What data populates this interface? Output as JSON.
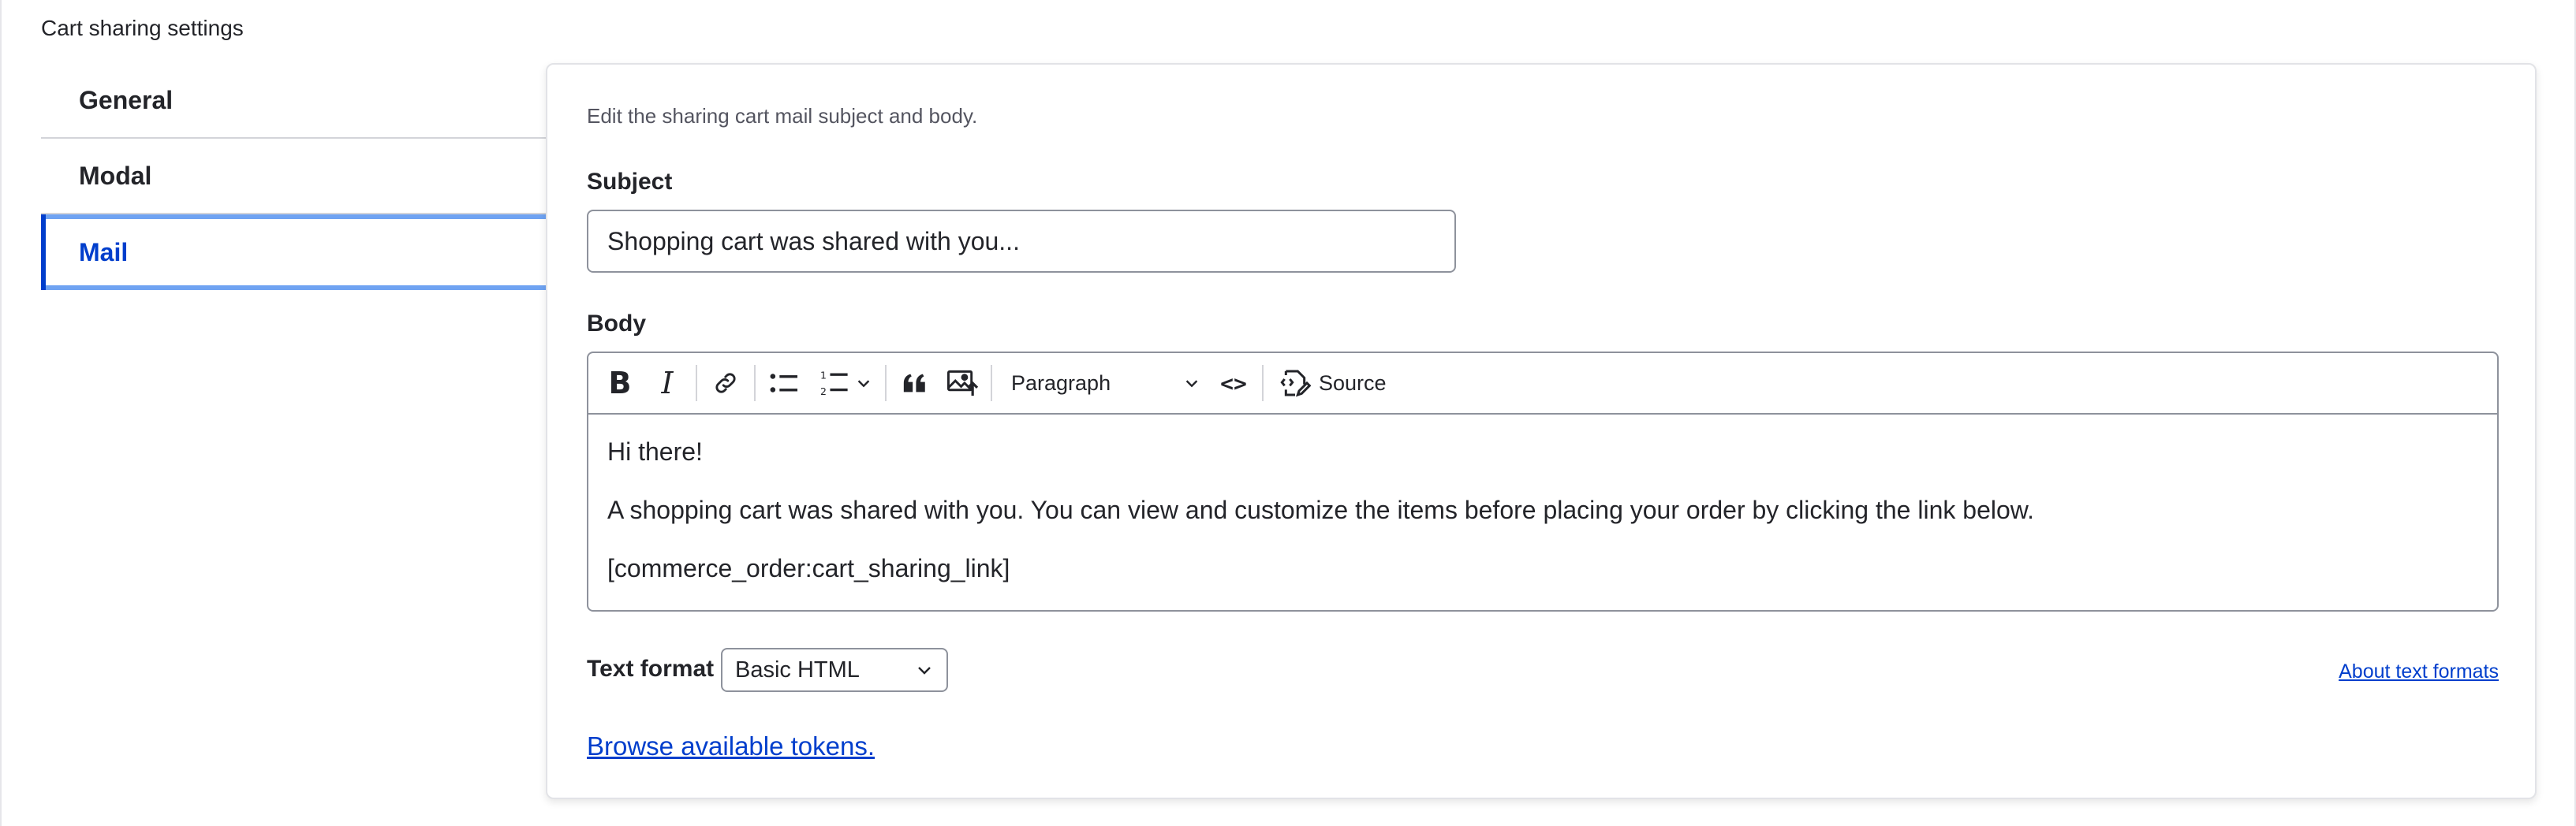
{
  "section": {
    "title": "Cart sharing settings"
  },
  "tabs": [
    {
      "label": "General",
      "active": false
    },
    {
      "label": "Modal",
      "active": false
    },
    {
      "label": "Mail",
      "active": true
    }
  ],
  "form": {
    "description": "Edit the sharing cart mail subject and body.",
    "subject_label": "Subject",
    "subject_value": "Shopping cart was shared with you...",
    "body_label": "Body",
    "toolbar": {
      "bold_glyph": "B",
      "italic_glyph": "I",
      "paragraph_label": "Paragraph",
      "code_glyph": "<>",
      "source_label": "Source",
      "icons": [
        "bold-icon",
        "italic-icon",
        "link-icon",
        "bulleted-list-icon",
        "numbered-list-icon",
        "blockquote-icon",
        "image-upload-icon",
        "code-icon",
        "source-icon"
      ]
    },
    "body_paragraphs": [
      "Hi there!",
      "A shopping cart was shared with you. You can view and customize the items before placing your order by clicking the link below.",
      "[commerce_order:cart_sharing_link]"
    ],
    "text_format_label": "Text format",
    "text_format_value": "Basic HTML",
    "about_formats_link": "About text formats",
    "browse_tokens_link": "Browse available tokens."
  },
  "colors": {
    "accent": "#003ecc",
    "active_tab_border": "#6fa3f2",
    "text": "#232429"
  }
}
